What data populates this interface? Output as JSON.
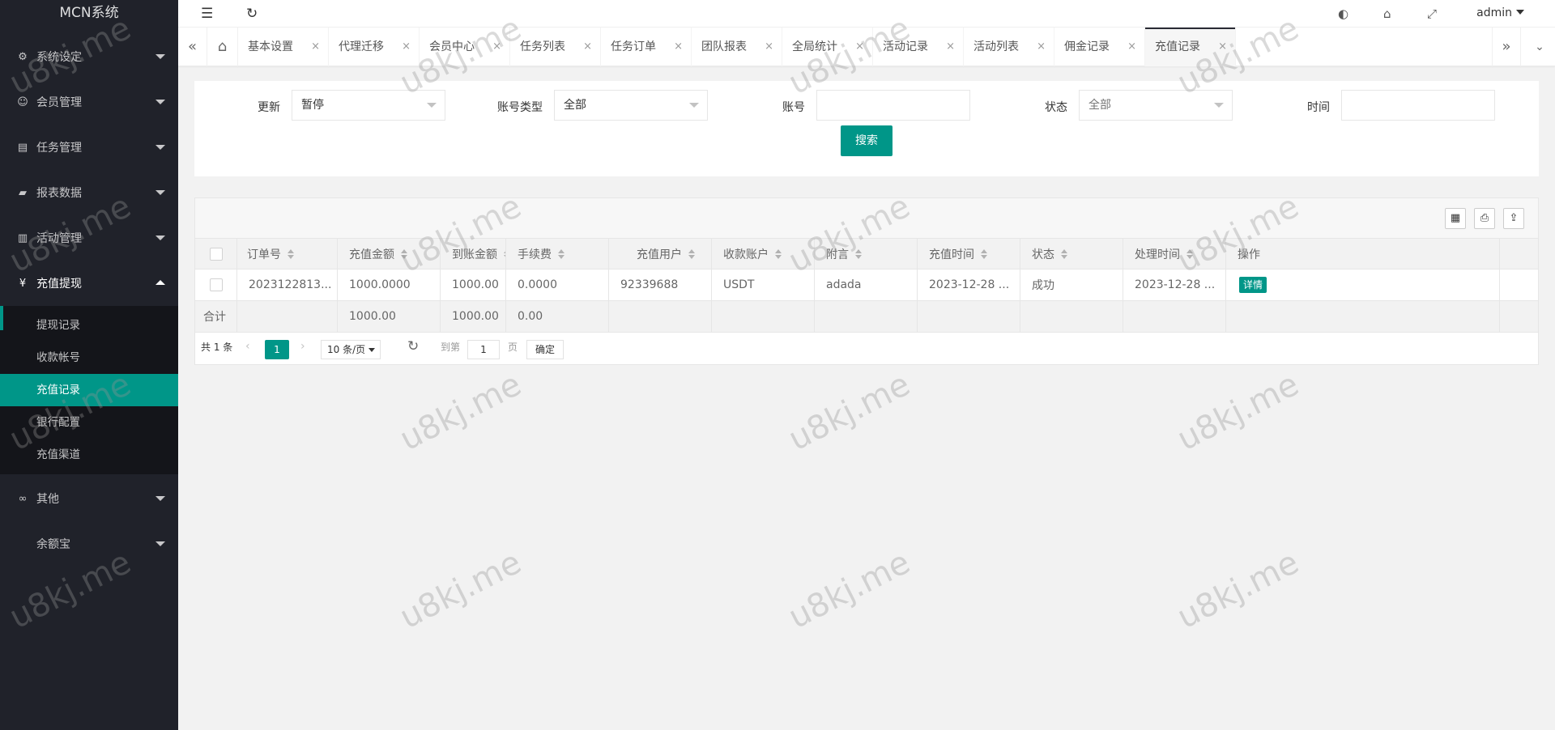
{
  "logo": "MCN系统",
  "sidebar": {
    "menus": [
      {
        "label": "系统设定",
        "icon": "gear-icon",
        "glyph": "⚙"
      },
      {
        "label": "会员管理",
        "icon": "user-icon",
        "glyph": "☺"
      },
      {
        "label": "任务管理",
        "icon": "document-icon",
        "glyph": "▤"
      },
      {
        "label": "报表数据",
        "icon": "chart-icon",
        "glyph": "▰"
      },
      {
        "label": "活动管理",
        "icon": "activity-icon",
        "glyph": "▥"
      },
      {
        "label": "充值提现",
        "icon": "currency-icon",
        "glyph": "¥"
      },
      {
        "label": "其他",
        "icon": "link-icon",
        "glyph": "∞"
      },
      {
        "label": "余额宝",
        "icon": "wallet-icon",
        "glyph": ""
      }
    ],
    "submenu": [
      {
        "label": "提现记录"
      },
      {
        "label": "收款帐号"
      },
      {
        "label": "充值记录"
      },
      {
        "label": "银行配置"
      },
      {
        "label": "充值渠道"
      }
    ]
  },
  "header": {
    "user": "admin"
  },
  "tabs": [
    {
      "label": "基本设置"
    },
    {
      "label": "代理迁移"
    },
    {
      "label": "会员中心"
    },
    {
      "label": "任务列表"
    },
    {
      "label": "任务订单"
    },
    {
      "label": "团队报表"
    },
    {
      "label": "全局统计"
    },
    {
      "label": "活动记录"
    },
    {
      "label": "活动列表"
    },
    {
      "label": "佣金记录"
    },
    {
      "label": "充值记录"
    }
  ],
  "filters": {
    "update_label": "更新",
    "update_value": "暂停",
    "account_type_label": "账号类型",
    "account_type_value": "全部",
    "account_label": "账号",
    "account_value": "",
    "status_label": "状态",
    "status_value": "全部",
    "time_label": "时间",
    "time_value": "",
    "search_button": "搜索"
  },
  "table": {
    "columns": [
      "订单号",
      "充值金额",
      "到账金额",
      "手续费",
      "充值用户",
      "收款账户",
      "附言",
      "充值时间",
      "状态",
      "处理时间",
      "操作"
    ],
    "rows": [
      {
        "order_no": "2023122813...",
        "amount": "1000.0000",
        "received": "1000.00",
        "fee": "0.0000",
        "user": "92339688",
        "account": "USDT",
        "remark": "adada",
        "recharge_time": "2023-12-28 ...",
        "status": "成功",
        "process_time": "2023-12-28 ...",
        "action": "详情"
      }
    ],
    "total": {
      "label": "合计",
      "amount": "1000.00",
      "received": "1000.00",
      "fee": "0.00"
    }
  },
  "pagination": {
    "total_text": "共 1 条",
    "current_page": "1",
    "page_size": "10 条/页",
    "goto_label": "到第",
    "goto_value": "1",
    "page_unit": "页",
    "confirm": "确定"
  },
  "watermark": "u8kj.me",
  "colors": {
    "accent": "#009688",
    "sidebar_bg": "#20222a",
    "submenu_bg": "#14151a"
  }
}
